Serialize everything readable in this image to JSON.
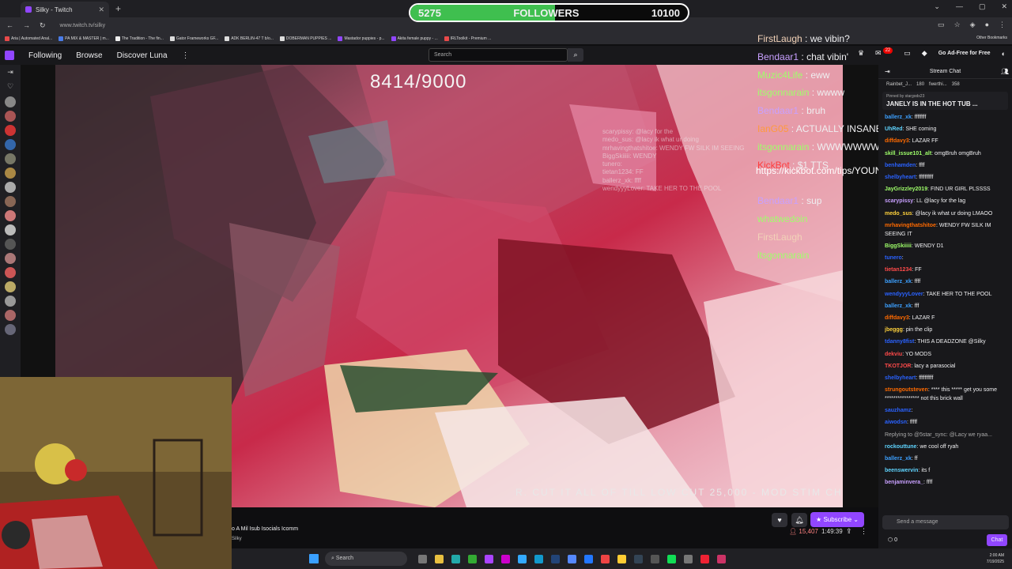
{
  "browser": {
    "tab_title": "Silky - Twitch",
    "url": "www.twitch.tv/silky",
    "bookmarks": [
      {
        "label": "Aria | Automated Anal...",
        "color": "#e84a4a"
      },
      {
        "label": "PA MIX & MASTER | m...",
        "color": "#4a7ce8"
      },
      {
        "label": "The Tradition - The fin...",
        "color": "#eeeeee"
      },
      {
        "label": "Gator Frameworks GF...",
        "color": "#dddddd"
      },
      {
        "label": "ADK BERLIN-47 T b/o...",
        "color": "#dddddd"
      },
      {
        "label": "DOBERMAN PUPPIES ...",
        "color": "#dddddd"
      },
      {
        "label": "Mastador puppies - p...",
        "color": "#9146ff"
      },
      {
        "label": "Akita female puppy - ...",
        "color": "#9146ff"
      },
      {
        "label": "IRLToolkit - Premium ...",
        "color": "#e84a4a"
      }
    ],
    "other_bookmarks": "Other Bookmarks"
  },
  "followers_goal": {
    "current": "5275",
    "label": "FOLLOWERS",
    "target": "10100",
    "progress": 0.52
  },
  "twitch_nav": {
    "links": [
      "Following",
      "Browse",
      "Discover Luna"
    ],
    "search_placeholder": "Search",
    "notification_count": "22",
    "ad_free": "Go Ad-Free for Free"
  },
  "video": {
    "counter": "8414/9000",
    "ticker": "R. CUT IT ALL OF TILL LOW CUT 25,000 - MOD STIM CHE",
    "kick_line": "https://kickbot.com/tips/YOUNGMAKESMUSIC",
    "overlay_chat": [
      {
        "user": "FirstLaugh",
        "text": "we vibin?",
        "color": "#f2d2b8"
      },
      {
        "user": "Bendaar1",
        "text": "chat vibin'",
        "color": "#c8a0ff"
      },
      {
        "user": "Muzic4Life",
        "text": "eww",
        "color": "#9fff6a"
      },
      {
        "user": "itsgonnarain",
        "text": "wwww",
        "color": "#9fff6a"
      },
      {
        "user": "Bendaar1",
        "text": "bruh",
        "color": "#c8a0ff"
      },
      {
        "user": "IanG05",
        "text": "ACTUALLY INSANE",
        "color": "#ff9a3c"
      },
      {
        "user": "itsgonnarain",
        "text": "WWWWWWWWWW",
        "color": "#9fff6a"
      },
      {
        "user": "KickBot",
        "text": "$1 TTS",
        "color": "#ff3c3c"
      },
      {
        "user": "",
        "text": "",
        "color": "#ffffff"
      },
      {
        "user": "Bendaar1",
        "text": "sup",
        "color": "#c8a0ff"
      },
      {
        "user": "whatwedoin",
        "text": "",
        "color": "#9fff6a"
      },
      {
        "user": "FirstLaugh",
        "text": "",
        "color": "#f2d2b8"
      },
      {
        "user": "itsgonnarain",
        "text": "",
        "color": "#9fff6a"
      }
    ],
    "faint_chat": [
      "scarypissy: @lacy for the",
      "medo_sus: @lacy ik what ur doing",
      "mrhavingthatshitoe: WENDY FW SILK IM SEEING",
      "BiggSkiiiii: WENDY",
      "tunero:",
      "tietan1234: FF",
      "ballerz_xk: ffff",
      "wendyyyLover: TAKE HER TO THE POOL"
    ]
  },
  "stream": {
    "title": "o A Mil Isub Isocials Icomm",
    "channel": "Silky",
    "subscribe": "Subscribe",
    "viewers": "15,407",
    "uptime": "1:49:39"
  },
  "chat": {
    "header": "Stream Chat",
    "leaderboard": [
      {
        "name": "Rainbet_J...",
        "value": "180"
      },
      {
        "name": "fwerthi...",
        "value": "358"
      }
    ],
    "pinned_by": "Pinned by stargods23",
    "pinned_text": "JANELY IS IN THE HOT TUB ...",
    "messages": [
      {
        "user": "ballerz_xk",
        "text": "ffffffff",
        "color": "#3ca0ff"
      },
      {
        "user": "UhRed",
        "text": "SHE coming",
        "color": "#5fd4ff"
      },
      {
        "user": "diffdavy3",
        "text": "LAZAR FF",
        "color": "#ff6a00"
      },
      {
        "user": "skill_issue101_alt",
        "text": "omgBruh omgBruh",
        "color": "#9fff6a"
      },
      {
        "user": "benhamden",
        "text": "ffff",
        "color": "#2a62ff"
      },
      {
        "user": "shelbyheart",
        "text": "ffffffffff",
        "color": "#2a62ff"
      },
      {
        "user": "JayGrizzley2019",
        "text": "FIND UR GIRL PLSSSS",
        "color": "#9fff6a"
      },
      {
        "user": "scarypissy",
        "text": "LL @lacy for the lag",
        "color": "#c8a0ff"
      },
      {
        "user": "medo_sus",
        "text": "@lacy ik what ur doing LMAOO",
        "color": "#ffd23c"
      },
      {
        "user": "mrhavingthatshitoe",
        "text": "WENDY FW SILK IM SEEING IT",
        "color": "#ff6a00",
        "wrap": true
      },
      {
        "user": "BiggSkiiiii",
        "text": "WENDY D1",
        "color": "#9fff6a"
      },
      {
        "user": "tunero",
        "text": "",
        "color": "#2a62ff"
      },
      {
        "user": "tietan1234",
        "text": "FF",
        "color": "#ff4a4a"
      },
      {
        "user": "ballerz_xk",
        "text": "ffff",
        "color": "#3ca0ff"
      },
      {
        "user": "wendyyyLover",
        "text": "TAKE HER TO THE POOL",
        "color": "#2a62ff"
      },
      {
        "user": "ballerz_xk",
        "text": "fff",
        "color": "#3ca0ff"
      },
      {
        "user": "diffdavy3",
        "text": "LAZAR F",
        "color": "#ff6a00"
      },
      {
        "user": "jbeggg",
        "text": "pin the clip",
        "color": "#ffd23c"
      },
      {
        "user": "tdanny8fist",
        "text": "THIS A DEADZONE @Silky",
        "color": "#2a62ff"
      },
      {
        "user": "dekviu",
        "text": "YO MODS",
        "color": "#ff4a4a"
      },
      {
        "user": "TKOTJOR",
        "text": "lacy a parasocial",
        "color": "#ff4a4a"
      },
      {
        "user": "shelbyheart",
        "text": "ffffffffff",
        "color": "#2a62ff"
      },
      {
        "user": "strungoutsteven",
        "text": "**** this ***** get you some **************** not this brick wall",
        "color": "#ff6a00",
        "wrap": true
      },
      {
        "user": "sauzhamz",
        "text": "",
        "color": "#2a62ff"
      },
      {
        "user": "aiwodsn",
        "text": "fffff",
        "color": "#2a62ff"
      },
      {
        "user": "",
        "text": "Replying to @5star_sync: @Lacy we ryaa...",
        "color": "#aaaaaa"
      },
      {
        "user": "rockouttune",
        "text": "we cool off ryah",
        "color": "#5fd4ff"
      },
      {
        "user": "ballerz_xk",
        "text": "ff",
        "color": "#3ca0ff"
      },
      {
        "user": "beenswervin",
        "text": "its f",
        "color": "#5fd4ff"
      },
      {
        "user": "benjaminvera_",
        "text": "ffff",
        "color": "#c8a0ff"
      }
    ],
    "input_placeholder": "Send a message",
    "points": "0",
    "chat_button": "Chat"
  },
  "taskbar": {
    "search": "Search",
    "time": "2:00 AM",
    "date": "7/19/2025"
  },
  "colors": {
    "twitch_purple": "#9146ff",
    "goal_green": "#3fbf4f"
  }
}
